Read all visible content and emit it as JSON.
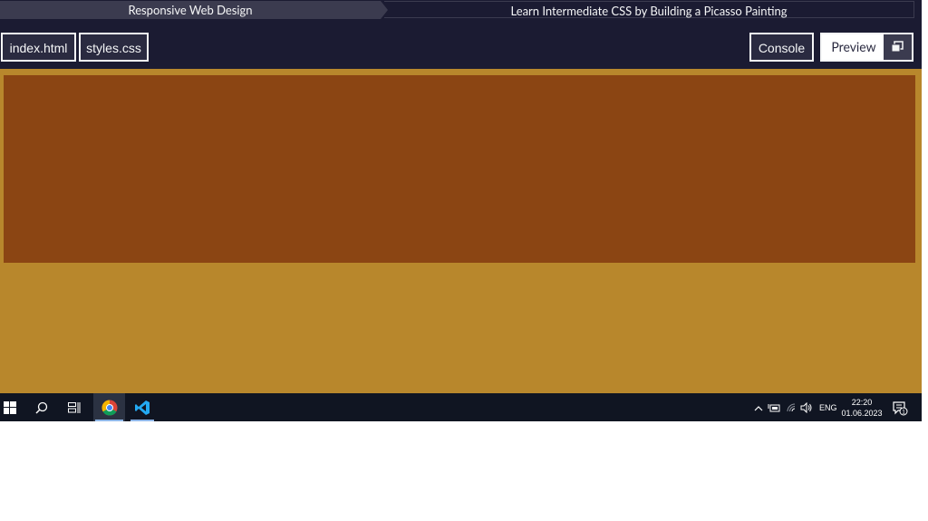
{
  "breadcrumb": {
    "course": "Responsive Web Design",
    "project": "Learn Intermediate CSS by Building a Picasso Painting"
  },
  "editor_tabs": {
    "index": "index.html",
    "styles": "styles.css"
  },
  "toolbar": {
    "console_label": "Console",
    "preview_label": "Preview",
    "preview_icon": "window-restore-icon"
  },
  "preview": {
    "background_color": "#b8872c",
    "block_color": "#8b4513"
  },
  "taskbar": {
    "apps": [
      "start",
      "search",
      "task-view",
      "chrome",
      "vscode"
    ],
    "language": "ENG",
    "time": "22:20",
    "date": "01.06.2023",
    "notification_count": "1"
  }
}
